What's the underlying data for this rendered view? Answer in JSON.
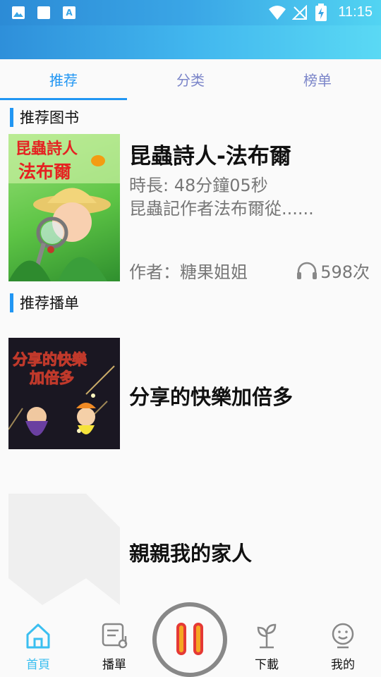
{
  "status_bar": {
    "time": "11:15",
    "left_icons": [
      "image-icon",
      "square-icon",
      "a-icon"
    ],
    "right_icons": [
      "wifi-icon",
      "no-signal-icon",
      "battery-charging-icon"
    ]
  },
  "tabs": [
    {
      "label": "推荐",
      "active": true
    },
    {
      "label": "分类",
      "active": false
    },
    {
      "label": "榜单",
      "active": false
    }
  ],
  "recommended_books": {
    "heading": "推荐图书",
    "items": [
      {
        "cover_text_line1": "昆蟲詩人",
        "cover_text_line2": "法布爾",
        "title": "昆蟲詩人-法布爾",
        "duration": "時長: 48分鐘05秒",
        "description": "昆蟲記作者法布爾從......",
        "author": "作者：糖果姐姐",
        "play_count": "598次"
      }
    ]
  },
  "recommended_playlists": {
    "heading": "推荐播单",
    "items": [
      {
        "cover_text_line1": "分享的快樂",
        "cover_text_line2": "加倍多",
        "title": "分享的快樂加倍多"
      },
      {
        "title": "親親我的家人"
      }
    ]
  },
  "bottom_nav": {
    "items": [
      {
        "label": "首頁",
        "icon": "home-icon",
        "active": true
      },
      {
        "label": "播單",
        "icon": "playlist-icon",
        "active": false
      },
      {
        "label": "下載",
        "icon": "sprout-icon",
        "active": false
      },
      {
        "label": "我的",
        "icon": "profile-icon",
        "active": false
      }
    ],
    "play_button_icon": "pause-icon"
  },
  "colors": {
    "accent": "#2196f3",
    "tab_inactive": "#7b85c9",
    "nav_active": "#3bbff0",
    "pause_bar": "#f5a623"
  }
}
